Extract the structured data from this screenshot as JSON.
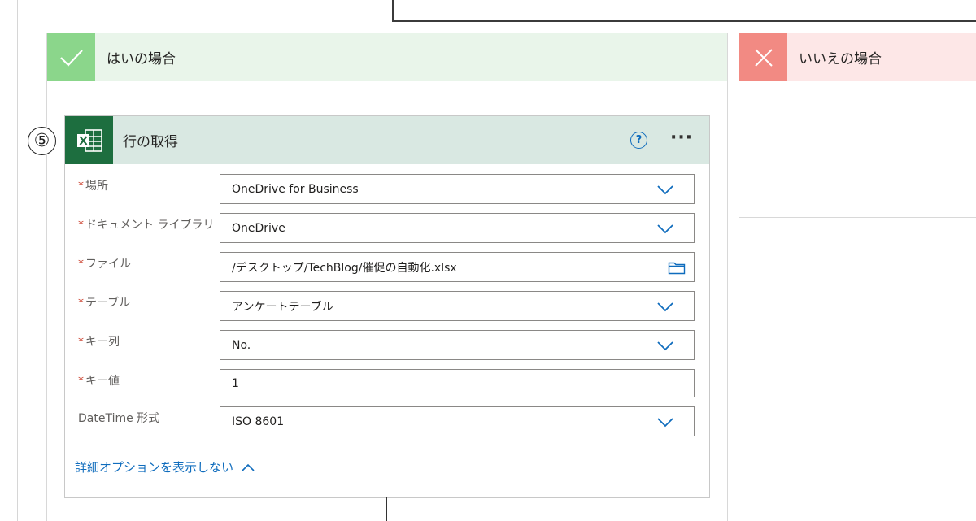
{
  "branches": {
    "yes": {
      "title": "はいの場合",
      "icon": "check-icon",
      "color": "#8bd68b"
    },
    "no": {
      "title": "いいえの場合",
      "icon": "close-icon",
      "color": "#f28a83"
    }
  },
  "step_number": "⑤",
  "action": {
    "title": "行の取得",
    "icon": "excel-icon",
    "help_icon": "?",
    "more_icon": "···",
    "fields": [
      {
        "label": "場所",
        "required": true,
        "value": "OneDrive for Business",
        "control": "dropdown"
      },
      {
        "label": "ドキュメント ライブラリ",
        "required": true,
        "value": "OneDrive",
        "control": "dropdown"
      },
      {
        "label": "ファイル",
        "required": true,
        "value": "/デスクトップ/TechBlog/催促の自動化.xlsx",
        "control": "file-picker"
      },
      {
        "label": "テーブル",
        "required": true,
        "value": "アンケートテーブル",
        "control": "dropdown"
      },
      {
        "label": "キー列",
        "required": true,
        "value": "No.",
        "control": "dropdown"
      },
      {
        "label": "キー値",
        "required": true,
        "value": "1",
        "control": "text"
      },
      {
        "label": "DateTime 形式",
        "required": false,
        "value": "ISO 8601",
        "control": "dropdown"
      }
    ],
    "advanced_toggle": "詳細オプションを表示しない",
    "required_marker": "*"
  },
  "colors": {
    "accent": "#0f6cbd",
    "excel": "#1d6e3f",
    "required": "#c8321e"
  }
}
